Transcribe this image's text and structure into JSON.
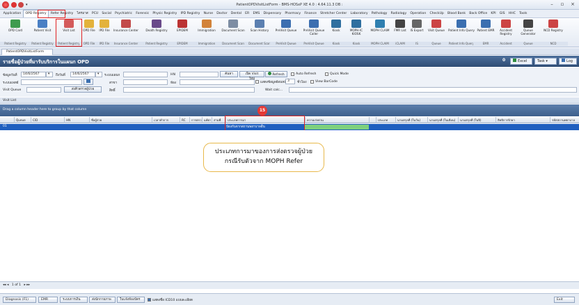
{
  "window": {
    "title": "PatientOPDVisitListForm - BMS-HOSxP XE 4.0 : 4.64.11.3 DB :"
  },
  "menu": [
    "Application",
    "OPD Registry",
    "Refer Registry",
    "ไตรมาส",
    "PCU",
    "Social",
    "Psychiatric",
    "Forensic",
    "Physic Registry",
    "IPD Registry",
    "Nurse",
    "Doctor",
    "Dental",
    "ER",
    "EMS",
    "Dispensary",
    "Pharmacy",
    "Finance",
    "Stretcher Center",
    "Laboratory",
    "Pathology",
    "Radiology",
    "Operation",
    "CheckUp",
    "Blood Bank",
    "Back Office",
    "KPI",
    "GIS",
    "HHC",
    "Tools"
  ],
  "ribbon": [
    {
      "label": "OPD Card",
      "group": "Patient Registry",
      "color": "#3e9b4f"
    },
    {
      "label": "Patient Visit",
      "group": "Patient Registry",
      "color": "#4a7fc4"
    },
    {
      "label": "Visit List",
      "group": "Patient Registry",
      "color": "#d45b5b"
    },
    {
      "label": "OPD File",
      "group": "OPD File",
      "color": "#e3b23c"
    },
    {
      "label": "IPD File",
      "group": "IPD File",
      "color": "#e3b23c"
    },
    {
      "label": "Insurance Center",
      "group": "Insurance Center",
      "color": "#c24a4a"
    },
    {
      "label": "Death Registry",
      "group": "Patient Registry",
      "color": "#6a4a8a"
    },
    {
      "label": "EPIDEM",
      "group": "EPIDEM",
      "color": "#b33"
    },
    {
      "label": "Immigration",
      "group": "Immigration",
      "color": "#d2833a"
    },
    {
      "label": "Document Scan",
      "group": "Document Scan",
      "color": "#7d8da3"
    },
    {
      "label": "Scan History",
      "group": "Document Scan",
      "color": "#5b7fb0"
    },
    {
      "label": "PreVisit Queue",
      "group": "PreVisit Queue",
      "color": "#3d6fb0"
    },
    {
      "label": "PreVisit Queue Caller",
      "group": "PreVisit Queue",
      "color": "#3d6fb0"
    },
    {
      "label": "Kiosk",
      "group": "Kiosk",
      "color": "#2f6f9f"
    },
    {
      "label": "MOPH-IC KIOSK",
      "group": "Kiosk",
      "color": "#2f6f9f"
    },
    {
      "label": "MOPH CLAIM",
      "group": "MOPH CLAIM",
      "color": "#2f7fb0"
    },
    {
      "label": "FMR List",
      "group": "iCLAIM",
      "color": "#444"
    },
    {
      "label": "IS Export",
      "group": "IS",
      "color": "#666"
    },
    {
      "label": "Visit Queue",
      "group": "Queue",
      "color": "#c44"
    },
    {
      "label": "Patient Info Query",
      "group": "Patient Info Query",
      "color": "#3b6fb0"
    },
    {
      "label": "Patient EMR",
      "group": "EMR",
      "color": "#3b6fb0"
    },
    {
      "label": "Accident Registry",
      "group": "Accident",
      "color": "#c44"
    },
    {
      "label": "Queue Generator",
      "group": "Queue",
      "color": "#444"
    },
    {
      "label": "NCD Registry",
      "group": "NCD",
      "color": "#c44"
    }
  ],
  "doc_tab": "PatientOPDVisitListForm",
  "page_title": "รายชื่อผู้ป่วยที่มารับบริการในแผนก OPD",
  "header_buttons": {
    "count": "0",
    "excel": "Excel",
    "task": "Task",
    "log": "Log"
  },
  "filter": {
    "visit_date_label": "ข้อมูลวันที่",
    "date_from": "14/6/2567",
    "to_label": "ถึงวันที่",
    "date_to": "14/6/2567",
    "dept_label": "ระบบแผนก",
    "hn_label": "HN",
    "search_btn": "ค้นหา",
    "open_visit_btn": "เปิด Visit ใหม่",
    "refresh_btn": "Refresh",
    "auto_refresh": "Auto Refresh",
    "quick_mode": "Quick Mode",
    "spclty_label": "ระบบแพทย์",
    "ward_label": "สาขา",
    "room_label": "ห้อง",
    "show_last_label": "แสดงข้อมูลย้อนหลัง",
    "hours_value": "3",
    "hours_label": "ชั่วโมง",
    "view_barcode": "View BarCode",
    "rights_label": "สิทธิ์",
    "visit_queue_label": "Visit Queue",
    "send_queue_btn": "ส่งคิวตรวจผู้ป่วย",
    "wait_calc": "Wait calc..."
  },
  "section": "Visit List",
  "group_hint": "Drag a column header here to group by that column",
  "columns": [
    "Queue",
    "CID",
    "HN",
    "ชื่อผู้ป่วย",
    "เวลาทำการ",
    "RC",
    "การตรวจ",
    "แพ้ยา",
    "สามพี่",
    "ประเภทการมา",
    "ความเร่งด่วน",
    "",
    "ประเภท",
    "นามสกุลที่ (ในวัน)",
    "นามสกุลที่ (ในเดือน)",
    "นามสกุลที่ (ในปี)",
    "สิทธิการรักษา",
    "รหัสสถานพยาบาล"
  ],
  "row": {
    "marker": "01",
    "visit_type": "ป้องกันจากสถานพยาบาลอื่น"
  },
  "annotation": {
    "badge": "15",
    "line1": "ประเภทการมาของการส่งตรวจผู้ป่วย",
    "line2": "กรณีรับตัวจาก MOPH Refer"
  },
  "pager": "1 of 1",
  "bottom_buttons": [
    "Diagnosis (F1)",
    "EMR",
    "ระบบการเงิน",
    "ส่งนักกายภาพ",
    "ใบแจ้งห้องบัตร",
    "แสดงชื่อ ICD10 แบบละเอียด",
    "Exit"
  ]
}
